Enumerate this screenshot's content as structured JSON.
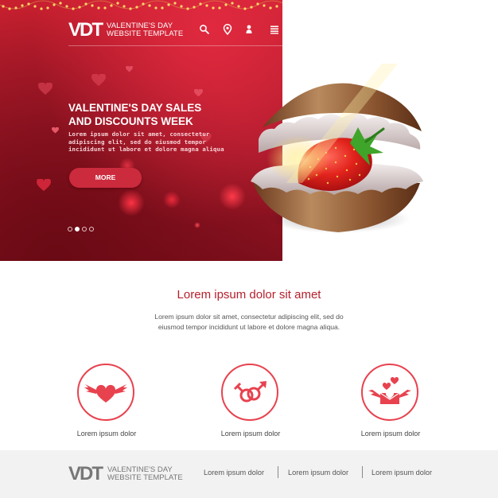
{
  "hero": {
    "logo_mark": "VDT",
    "logo_line1": "VALENTINE'S DAY",
    "logo_line2": "WEBSITE TEMPLATE",
    "nav_icons": [
      "search-icon",
      "location-pin-icon",
      "user-icon",
      "menu-list-icon"
    ],
    "title_line1": "VALENTINE'S DAY SALES",
    "title_line2": "AND DISCOUNTS WEEK",
    "desc_line1": "Lorem ipsum dolor sit amet, consectetur",
    "desc_line2": "adipiscing elit, sed do eiusmod tempor",
    "desc_line3": "incididunt ut labore et dolore magna aliqua",
    "more_label": "MORE",
    "slides_count": 4,
    "active_slide": 2,
    "image_alt": "strawberry in seashell"
  },
  "section": {
    "title": "Lorem ipsum dolor sit amet",
    "desc_line1": "Lorem ipsum dolor sit amet, consectetur adipiscing elit, sed do",
    "desc_line2": "eiusmod tempor incididunt ut labore et dolore magna aliqua."
  },
  "features": [
    {
      "icon": "winged-heart-icon",
      "label": "Lorem ipsum dolor"
    },
    {
      "icon": "gender-symbols-icon",
      "label": "Lorem ipsum dolor"
    },
    {
      "icon": "love-letter-icon",
      "label": "Lorem ipsum dolor"
    }
  ],
  "footer": {
    "logo_mark": "VDT",
    "logo_line1": "VALENTINE'S DAY",
    "logo_line2": "WEBSITE TEMPLATE",
    "links": [
      "Lorem ipsum dolor",
      "Lorem ipsum dolor",
      "Lorem ipsum dolor"
    ]
  },
  "colors": {
    "hero_red": "#b81d2d",
    "accent_red": "#e8424f",
    "title_red": "#b5202d",
    "footer_bg": "#f2f2f2"
  }
}
